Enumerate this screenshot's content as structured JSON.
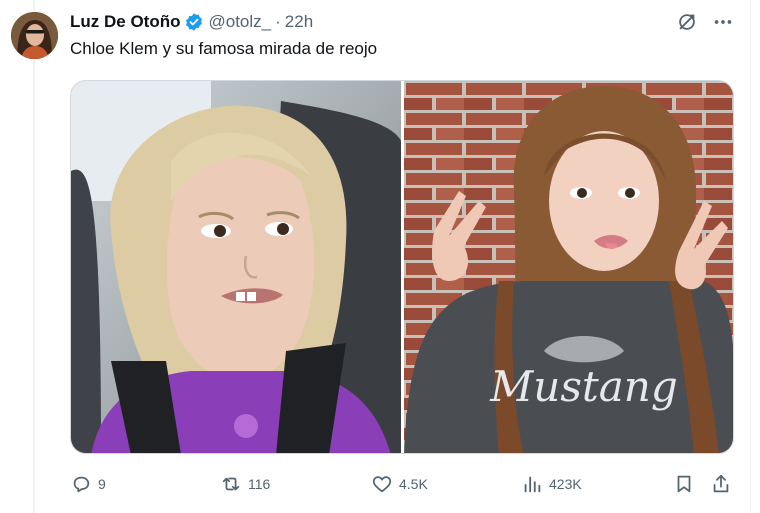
{
  "tweet": {
    "author_name": "Luz De Otoño",
    "verified": true,
    "handle": "@otolz_",
    "separator": "·",
    "time": "22h",
    "text": "Chloe Klem y su famosa mirada de reojo"
  },
  "media": {
    "left_photo": {
      "subject": "little girl in car seat side-eye",
      "colors": {
        "hair": "#d9c89f",
        "shirt": "#8a3fb8",
        "seat": "#3a3d42",
        "skin": "#e9c7b3"
      }
    },
    "right_photo": {
      "subject": "young woman in front of brick wall making peace signs",
      "sweatshirt_text": "Mustang",
      "colors": {
        "brick": "#a5543f",
        "hair": "#8a5a35",
        "sweatshirt": "#4a4d52",
        "skin": "#f2cfbf"
      }
    }
  },
  "actions": {
    "replies": "9",
    "reposts": "116",
    "likes": "4.5K",
    "views": "423K"
  },
  "icons": {
    "verified": "verified-badge-icon",
    "grok": "grok-icon",
    "more": "more-icon",
    "reply": "reply-icon",
    "repost": "repost-icon",
    "like": "heart-icon",
    "views": "views-icon",
    "bookmark": "bookmark-icon",
    "share": "share-icon"
  },
  "colors": {
    "text": "#0f1419",
    "muted": "#536471",
    "verified": "#1d9bf0",
    "border": "#cfd9de"
  }
}
